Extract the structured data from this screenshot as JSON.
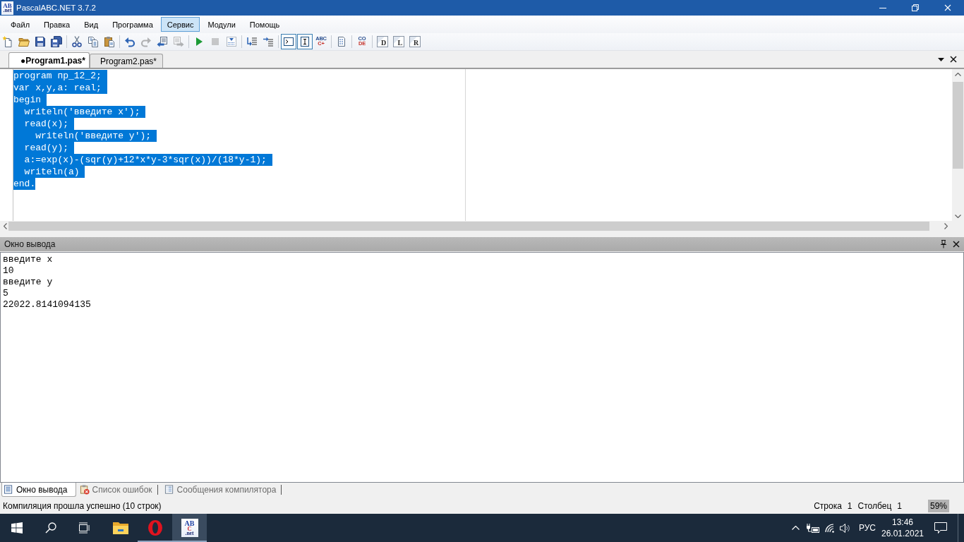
{
  "window": {
    "title": "PascalABC.NET 3.7.2",
    "logo_text": [
      "AB",
      ".net"
    ]
  },
  "menu": {
    "items": [
      {
        "label": "Файл",
        "selected": false
      },
      {
        "label": "Правка",
        "selected": false
      },
      {
        "label": "Вид",
        "selected": false
      },
      {
        "label": "Программа",
        "selected": false
      },
      {
        "label": "Сервис",
        "selected": true
      },
      {
        "label": "Модули",
        "selected": false
      },
      {
        "label": "Помощь",
        "selected": false
      }
    ]
  },
  "toolbar": {
    "groups": [
      [
        {
          "kind": "icon",
          "disabled": false,
          "pressed": false
        },
        {
          "kind": "icon",
          "disabled": false,
          "pressed": false
        },
        {
          "kind": "icon",
          "disabled": false,
          "pressed": false
        },
        {
          "kind": "icon",
          "disabled": false,
          "pressed": false
        }
      ],
      [
        {
          "kind": "icon",
          "disabled": false,
          "pressed": false
        },
        {
          "kind": "icon",
          "disabled": false,
          "pressed": false
        },
        {
          "kind": "icon",
          "disabled": false,
          "pressed": false
        }
      ],
      [
        {
          "kind": "icon",
          "disabled": false,
          "pressed": false
        },
        {
          "kind": "icon",
          "disabled": true,
          "pressed": false
        },
        {
          "kind": "icon",
          "disabled": false,
          "pressed": false
        },
        {
          "kind": "icon",
          "disabled": true,
          "pressed": false
        }
      ],
      [
        {
          "kind": "icon",
          "disabled": false,
          "pressed": false
        },
        {
          "kind": "icon",
          "disabled": true,
          "pressed": false
        },
        {
          "kind": "icon",
          "disabled": false,
          "pressed": false
        }
      ],
      [
        {
          "kind": "icon",
          "disabled": false,
          "pressed": false
        },
        {
          "kind": "icon",
          "disabled": false,
          "pressed": false
        }
      ],
      [
        {
          "kind": "icon",
          "disabled": false,
          "pressed": true
        },
        {
          "kind": "icon",
          "disabled": false,
          "pressed": true
        },
        {
          "kind": "glyph",
          "lines": [
            "ABC",
            "C+"
          ],
          "disabled": false,
          "pressed": false
        }
      ],
      [
        {
          "kind": "icon",
          "disabled": false,
          "pressed": false
        }
      ],
      [
        {
          "kind": "glyph",
          "lines": [
            "CO",
            "DE"
          ],
          "disabled": false,
          "pressed": false
        }
      ],
      [
        {
          "kind": "glyph",
          "lines": [
            "D"
          ],
          "disabled": false,
          "pressed": false
        },
        {
          "kind": "glyph",
          "lines": [
            "L"
          ],
          "disabled": false,
          "pressed": false
        },
        {
          "kind": "glyph",
          "lines": [
            "R"
          ],
          "disabled": false,
          "pressed": false
        }
      ]
    ]
  },
  "editor_tabs": [
    {
      "label": "●Program1.pas*",
      "selected": true
    },
    {
      "label": "Program2.pas*",
      "selected": false
    }
  ],
  "editor": {
    "lines": [
      {
        "text": "program пр_12_2;",
        "selected": true
      },
      {
        "text": "var x,y,a: real;",
        "selected": true
      },
      {
        "text": "begin",
        "selected": true
      },
      {
        "text": "  writeln('введите x');",
        "selected": true
      },
      {
        "text": "  read(x);",
        "selected": true
      },
      {
        "text": "    writeln('введите y');",
        "selected": true
      },
      {
        "text": "  read(y);",
        "selected": true
      },
      {
        "text": "  a:=exp(x)-(sqr(y)+12*x*y-3*sqr(x))/(18*y-1);",
        "selected": true
      },
      {
        "text": "  writeln(a)",
        "selected": true
      },
      {
        "text": "end.",
        "selected": true
      }
    ]
  },
  "output_panel": {
    "title": "Окно вывода",
    "lines": [
      "введите x",
      "10",
      "введите y",
      "5",
      "22022.8141094135"
    ]
  },
  "dock_tabs": [
    {
      "label": "Окно вывода",
      "selected": true
    },
    {
      "label": "Список ошибок",
      "selected": false
    },
    {
      "label": "Сообщения компилятора",
      "selected": false
    }
  ],
  "status_bar": {
    "message": "Компиляция прошла успешно (10 строк)",
    "position": [
      {
        "label": "Строка",
        "value": "1"
      },
      {
        "label": "Столбец",
        "value": "1"
      }
    ],
    "zoom": "59%"
  },
  "taskbar": {
    "apps": [
      {
        "kind": "icon",
        "running": false,
        "active": false
      },
      {
        "kind": "icon",
        "running": true,
        "active": false
      },
      {
        "kind": "logo",
        "logo_text": [
          "AB",
          "C",
          ".net"
        ],
        "running": true,
        "active": true
      }
    ],
    "tray": {
      "language": "РУС",
      "time": "13:46",
      "date": "26.01.2021"
    }
  }
}
